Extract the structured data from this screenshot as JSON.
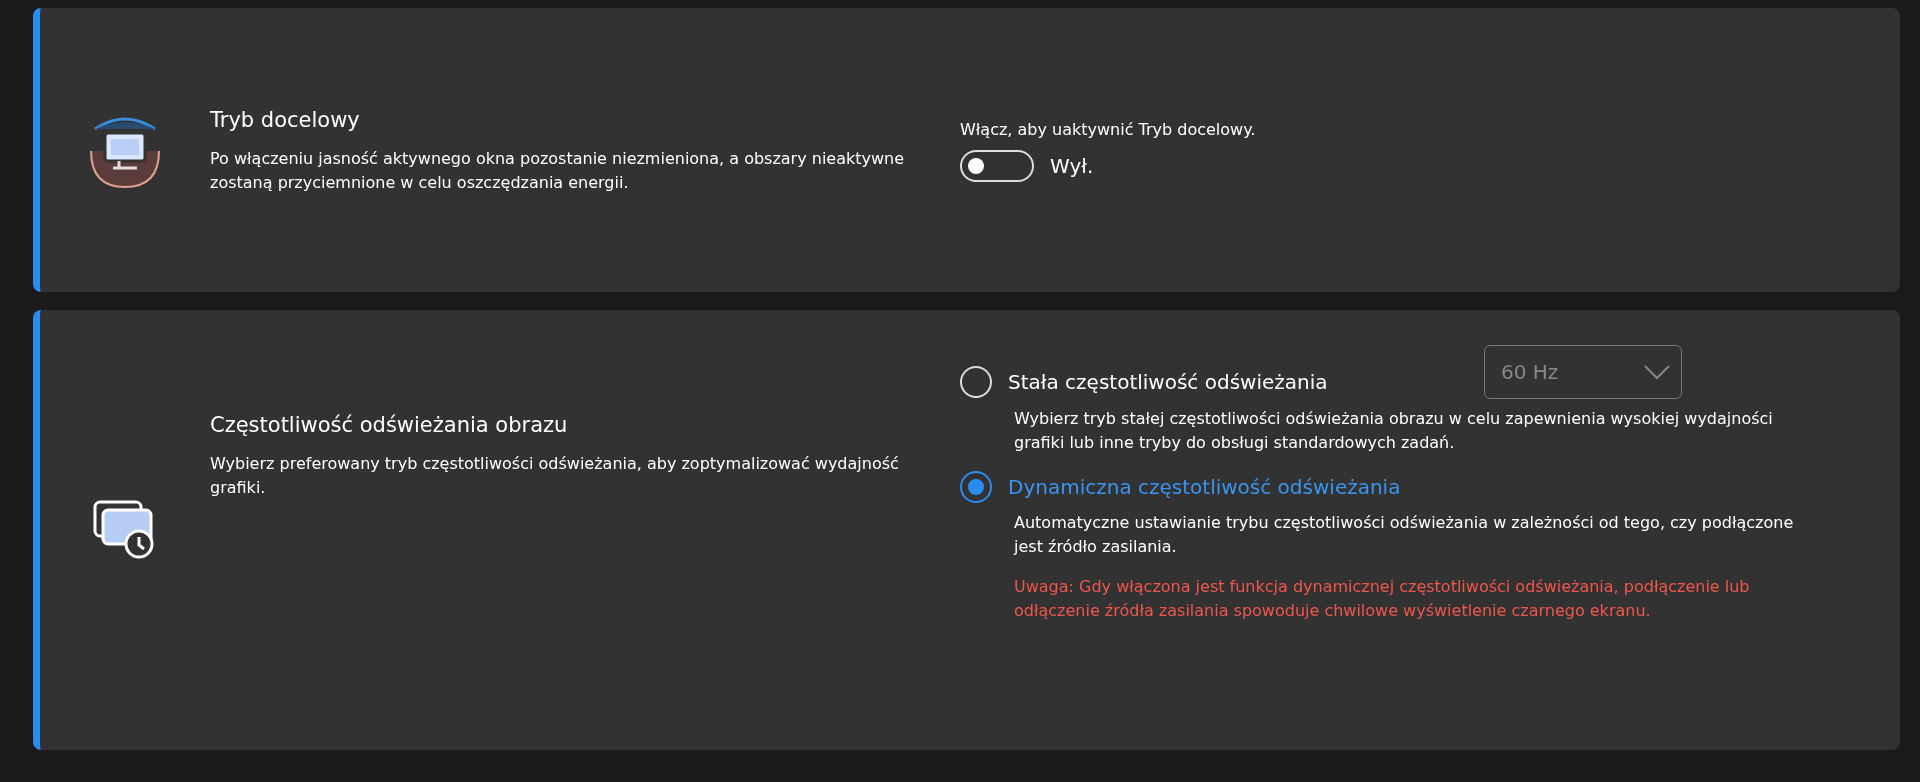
{
  "sections": [
    {
      "kind": "target_mode",
      "title": "Tryb docelowy",
      "description": "Po włączeniu jasność aktywnego okna pozostanie niezmieniona, a obszary nieaktywne zostaną przyciemnione w celu oszczędzania energii.",
      "control_label": "Włącz, aby uaktywnić Tryb docelowy.",
      "toggle": {
        "on": false,
        "state_label": "Wył."
      }
    },
    {
      "kind": "refresh_rate",
      "title": "Częstotliwość odświeżania obrazu",
      "description": "Wybierz preferowany tryb częstotliwości odświeżania, aby zoptymalizować wydajność grafiki.",
      "options": [
        {
          "label": "Stała częstotliwość odświeżania",
          "selected": false,
          "description": "Wybierz tryb stałej częstotliwości odświeżania obrazu w celu zapewnienia wysokiej wydajności grafiki lub inne tryby do obsługi standardowych zadań.",
          "dropdown": {
            "value": "60  Hz"
          }
        },
        {
          "label": "Dynamiczna częstotliwość odświeżania",
          "selected": true,
          "description": "Automatyczne ustawianie trybu częstotliwości odświeżania w zależności od tego, czy podłączone jest źródło zasilania.",
          "warning": "Uwaga: Gdy włączona jest funkcja dynamicznej częstotliwości odświeżania, podłączenie lub odłączenie źródła zasilania spowoduje chwilowe wyświetlenie czarnego ekranu."
        }
      ]
    }
  ]
}
